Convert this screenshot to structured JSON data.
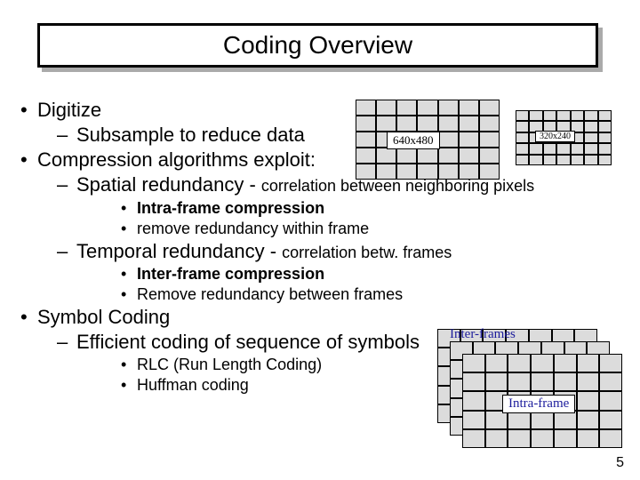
{
  "title": "Coding Overview",
  "bullets": {
    "digitize": "Digitize",
    "subsample": "Subsample to reduce data",
    "compression_exploit": "Compression algorithms exploit:",
    "spatial": "Spatial redundancy",
    "spatial_desc": "correlation between neighboring pixels",
    "intra_comp": "Intra-frame compression",
    "intra_remove": "remove redundancy within frame",
    "temporal": "Temporal redundancy",
    "temporal_desc": "correlation betw. frames",
    "inter_comp": "Inter-frame compression",
    "inter_remove": "Remove redundancy between frames",
    "symbol": "Symbol Coding",
    "symbol_eff": "Efficient coding of sequence of symbols",
    "rlc": "RLC (Run Length Coding)",
    "huffman": "Huffman coding"
  },
  "labels": {
    "res1": "640x480",
    "res2": "320x240",
    "interframes": "Inter-frames",
    "intraframe": "Intra-frame"
  },
  "page_number": "5"
}
